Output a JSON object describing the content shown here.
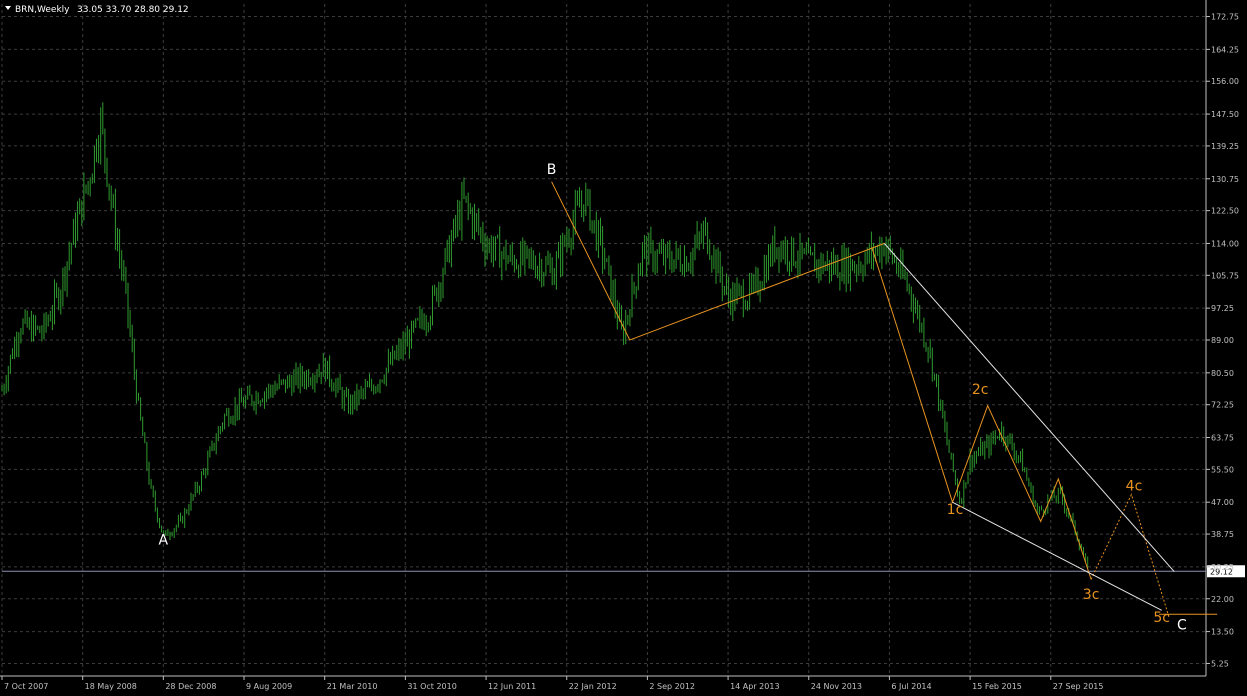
{
  "header": {
    "symbol": "BRN,Weekly",
    "ohlc": "33.05 33.70 28.80 29.12"
  },
  "colors": {
    "background": "#000000",
    "grid": "#3c3c3c",
    "axis": "#c0c0c0",
    "candle": "#2f9b2f",
    "wave": "#e8931f",
    "channel": "#e6e6e6",
    "bid_line": "#8c8fb0"
  },
  "chart_data": {
    "type": "line",
    "y_scale": "linear",
    "ylim": [
      2.0,
      176.0
    ],
    "y_ticks": [
      "172.75",
      "164.25",
      "156.00",
      "147.50",
      "139.25",
      "130.75",
      "122.50",
      "114.00",
      "105.75",
      "97.25",
      "89.00",
      "80.50",
      "72.25",
      "63.75",
      "55.50",
      "47.00",
      "38.75",
      "30.25",
      "22.00",
      "13.50",
      "5.25"
    ],
    "current_price": "29.12",
    "x_ticks": [
      "7 Oct 2007",
      "18 May 2008",
      "28 Dec 2008",
      "9 Aug 2009",
      "21 Mar 2010",
      "31 Oct 2010",
      "12 Jun 2011",
      "22 Jan 2012",
      "2 Sep 2012",
      "14 Apr 2013",
      "24 Nov 2013",
      "6 Jul 2014",
      "15 Feb 2015",
      "27 Sep 2015"
    ],
    "grid": true,
    "price_series": [
      {
        "date": "2007-10-07",
        "price": 76
      },
      {
        "date": "2007-11-25",
        "price": 93
      },
      {
        "date": "2008-01-27",
        "price": 91
      },
      {
        "date": "2008-03-16",
        "price": 102
      },
      {
        "date": "2008-04-27",
        "price": 118
      },
      {
        "date": "2008-06-08",
        "price": 132
      },
      {
        "date": "2008-07-06",
        "price": 146
      },
      {
        "date": "2008-08-10",
        "price": 122
      },
      {
        "date": "2008-09-14",
        "price": 101
      },
      {
        "date": "2008-10-19",
        "price": 72
      },
      {
        "date": "2008-11-23",
        "price": 50
      },
      {
        "date": "2008-12-28",
        "price": 38
      },
      {
        "date": "2009-02-15",
        "price": 42
      },
      {
        "date": "2009-04-12",
        "price": 53
      },
      {
        "date": "2009-06-14",
        "price": 69
      },
      {
        "date": "2009-08-09",
        "price": 73
      },
      {
        "date": "2009-10-18",
        "price": 76
      },
      {
        "date": "2010-01-10",
        "price": 79
      },
      {
        "date": "2010-03-21",
        "price": 82
      },
      {
        "date": "2010-05-23",
        "price": 72
      },
      {
        "date": "2010-08-01",
        "price": 77
      },
      {
        "date": "2010-10-31",
        "price": 88
      },
      {
        "date": "2011-01-09",
        "price": 97
      },
      {
        "date": "2011-03-06",
        "price": 114
      },
      {
        "date": "2011-04-10",
        "price": 125
      },
      {
        "date": "2011-06-12",
        "price": 114
      },
      {
        "date": "2011-08-14",
        "price": 110
      },
      {
        "date": "2011-10-23",
        "price": 109
      },
      {
        "date": "2011-12-18",
        "price": 107
      },
      {
        "date": "2012-02-05",
        "price": 119
      },
      {
        "date": "2012-03-11",
        "price": 126
      },
      {
        "date": "2012-05-06",
        "price": 110
      },
      {
        "date": "2012-06-24",
        "price": 90
      },
      {
        "date": "2012-08-19",
        "price": 112
      },
      {
        "date": "2012-10-21",
        "price": 110
      },
      {
        "date": "2012-12-23",
        "price": 110
      },
      {
        "date": "2013-02-10",
        "price": 117
      },
      {
        "date": "2013-04-14",
        "price": 100
      },
      {
        "date": "2013-06-23",
        "price": 101
      },
      {
        "date": "2013-08-25",
        "price": 114
      },
      {
        "date": "2013-11-24",
        "price": 109
      },
      {
        "date": "2014-02-16",
        "price": 108
      },
      {
        "date": "2014-04-20",
        "price": 109
      },
      {
        "date": "2014-06-22",
        "price": 114
      },
      {
        "date": "2014-08-31",
        "price": 102
      },
      {
        "date": "2014-10-26",
        "price": 86
      },
      {
        "date": "2014-12-14",
        "price": 62
      },
      {
        "date": "2015-01-18",
        "price": 47
      },
      {
        "date": "2015-02-15",
        "price": 58
      },
      {
        "date": "2015-04-12",
        "price": 62
      },
      {
        "date": "2015-05-10",
        "price": 66
      },
      {
        "date": "2015-07-05",
        "price": 58
      },
      {
        "date": "2015-08-23",
        "price": 44
      },
      {
        "date": "2015-09-27",
        "price": 48
      },
      {
        "date": "2015-10-25",
        "price": 49
      },
      {
        "date": "2015-12-06",
        "price": 39
      },
      {
        "date": "2016-01-10",
        "price": 29
      }
    ],
    "wave_labels": [
      {
        "text": "A",
        "date": "2008-12-28",
        "price": 36,
        "color": "white"
      },
      {
        "text": "B",
        "date": "2011-12-11",
        "price": 132,
        "color": "white"
      },
      {
        "text": "1c",
        "date": "2015-01-04",
        "price": 44,
        "color": "orange"
      },
      {
        "text": "2c",
        "date": "2015-03-15",
        "price": 75,
        "color": "orange"
      },
      {
        "text": "3c",
        "date": "2016-01-17",
        "price": 22,
        "color": "orange"
      },
      {
        "text": "4c",
        "date": "2016-05-15",
        "price": 50,
        "color": "orange"
      },
      {
        "text": "5c",
        "date": "2016-07-31",
        "price": 16,
        "color": "orange"
      },
      {
        "text": "C",
        "date": "2016-09-25",
        "price": 14,
        "color": "white"
      }
    ],
    "wave_lines": [
      {
        "points": [
          {
            "date": "2011-12-11",
            "price": 130
          },
          {
            "date": "2012-07-15",
            "price": 89
          },
          {
            "date": "2014-06-22",
            "price": 114
          }
        ],
        "style": "solid"
      },
      {
        "points": [
          {
            "date": "2014-05-18",
            "price": 113
          },
          {
            "date": "2014-12-28",
            "price": 47
          },
          {
            "date": "2015-04-05",
            "price": 72
          },
          {
            "date": "2015-08-30",
            "price": 42
          },
          {
            "date": "2015-10-18",
            "price": 53
          },
          {
            "date": "2016-01-17",
            "price": 27
          }
        ],
        "style": "solid"
      },
      {
        "points": [
          {
            "date": "2016-01-17",
            "price": 27
          },
          {
            "date": "2016-05-08",
            "price": 49
          },
          {
            "date": "2016-08-21",
            "price": 17
          }
        ],
        "style": "dashed"
      },
      {
        "points": [
          {
            "date": "2016-07-24",
            "price": 18
          },
          {
            "date": "2017-01-01",
            "price": 18
          }
        ],
        "style": "solid"
      }
    ],
    "channel_lines": [
      {
        "start": {
          "date": "2014-06-22",
          "price": 114
        },
        "end": {
          "date": "2016-09-04",
          "price": 29
        }
      },
      {
        "start": {
          "date": "2014-12-28",
          "price": 47
        },
        "end": {
          "date": "2016-07-31",
          "price": 19
        }
      }
    ]
  }
}
